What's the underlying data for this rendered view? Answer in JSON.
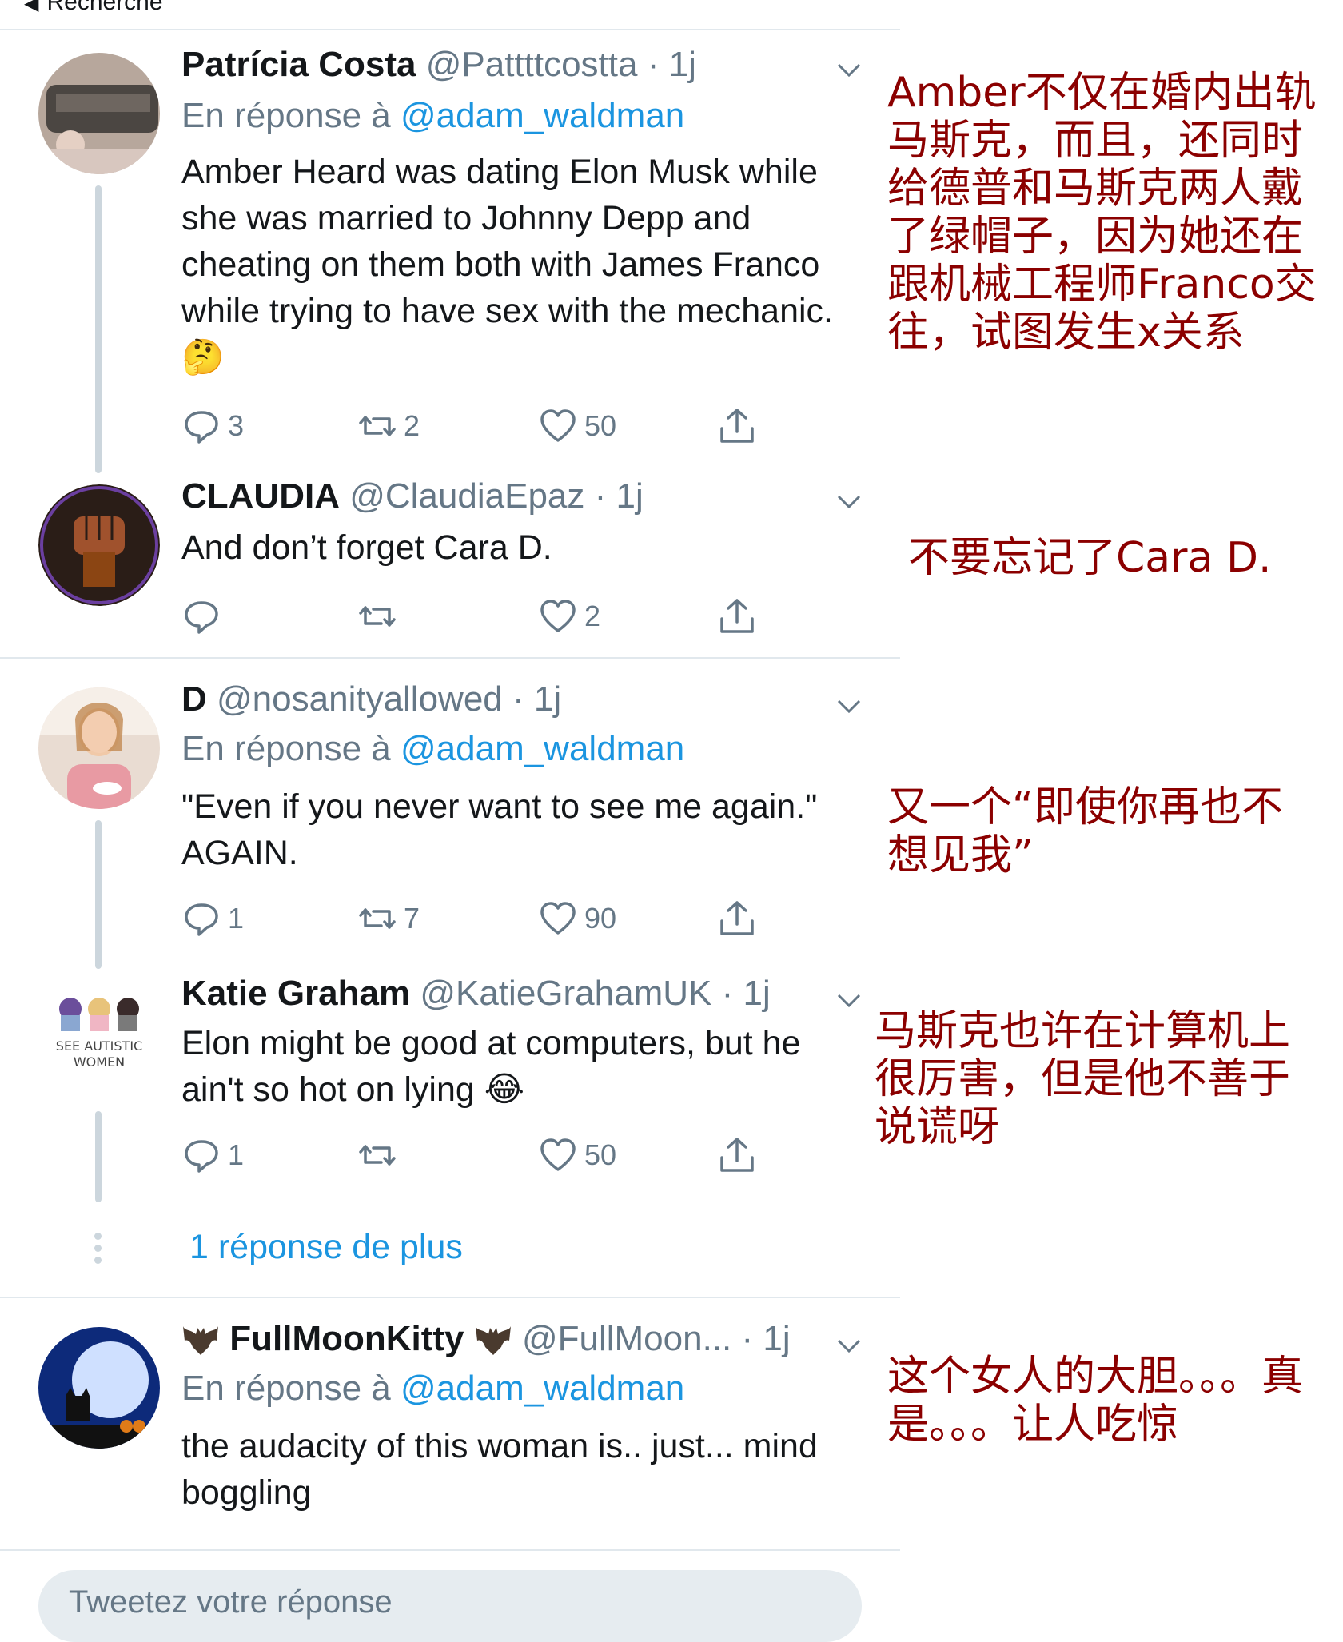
{
  "header": {
    "back_label": "Recherche"
  },
  "tweets": [
    {
      "name": "Patrícia Costa",
      "handle": "@Pattttcostta",
      "time": "· 1j",
      "reply_prefix": "En réponse à",
      "reply_to": "@adam_waldman",
      "text": "Amber Heard was dating Elon Musk while she was married to Johnny Depp and cheating on them both with James Franco while trying to have sex with the mechanic. 🤔",
      "replies": "3",
      "retweets": "2",
      "likes": "50",
      "annotation": "Amber不仅在婚内出轨马斯克，而且，还同时给德普和马斯克两人戴了绿帽子，因为她还在跟机械工程师Franco交往，试图发生x关系"
    },
    {
      "name": "CLAUDIA",
      "handle": "@ClaudiaEpaz",
      "time": "· 1j",
      "text": "And don’t forget Cara D.",
      "replies": "",
      "retweets": "",
      "likes": "2",
      "annotation": "不要忘记了Cara D."
    },
    {
      "name": "D",
      "handle": "@nosanityallowed",
      "time": "· 1j",
      "reply_prefix": "En réponse à",
      "reply_to": "@adam_waldman",
      "text": "\"Even if you never want to see me again.\" AGAIN.",
      "replies": "1",
      "retweets": "7",
      "likes": "90",
      "annotation": "又一个“即使你再也不想见我”"
    },
    {
      "name": "Katie Graham",
      "handle": "@KatieGrahamUK",
      "time": "· 1j",
      "text": "Elon might be good at computers, but he ain't so hot on lying 😂",
      "replies": "1",
      "retweets": "",
      "likes": "50",
      "avatar_text": "SEE AUTISTIC WOMEN",
      "annotation": "马斯克也许在计算机上很厉害，但是他不善于说谎呀"
    },
    {
      "name": "FullMoonKitty",
      "handle": "@FullMoon...",
      "time": "· 1j",
      "reply_prefix": "En réponse à",
      "reply_to": "@adam_waldman",
      "text": "the audacity of this woman is.. just... mind boggling",
      "annotation": "这个女人的大胆。。。真是。。。让人吃惊"
    }
  ],
  "more_replies": "1 réponse de plus",
  "compose": {
    "placeholder": "Tweetez votre réponse"
  },
  "colors": {
    "link": "#1b95e0",
    "muted": "#657786",
    "annotation": "#8b0000",
    "divider": "#e1e8ed"
  },
  "icons": [
    "reply-icon",
    "retweet-icon",
    "like-icon",
    "share-icon",
    "chevron-down-icon",
    "bat-icon"
  ]
}
